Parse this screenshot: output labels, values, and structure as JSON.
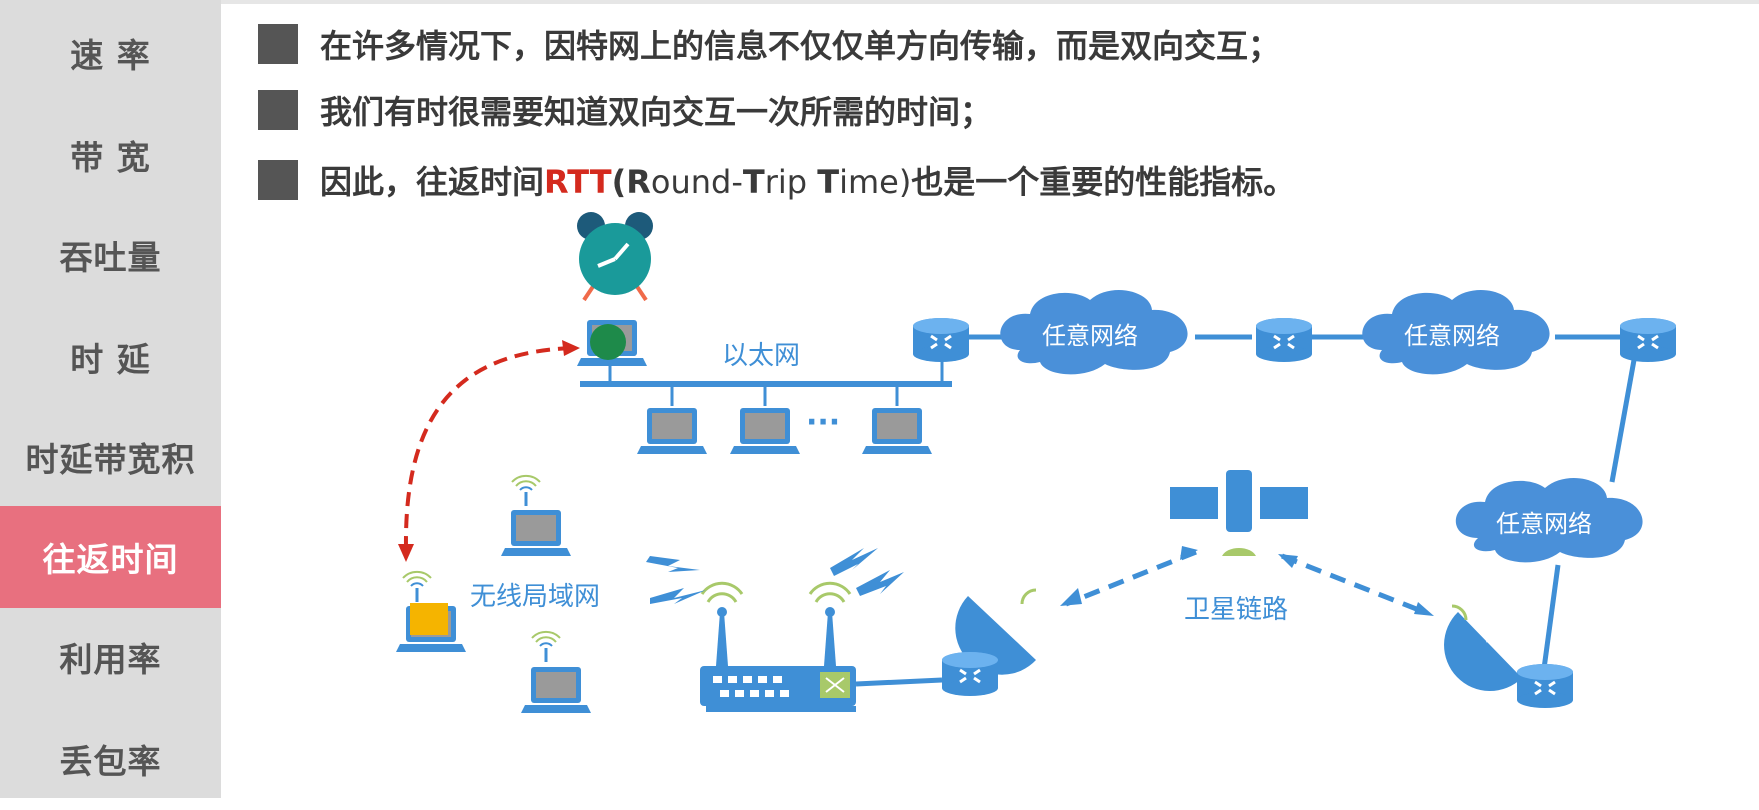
{
  "sidebar": {
    "items": [
      {
        "label": "速 率"
      },
      {
        "label": "带 宽"
      },
      {
        "label": "吞吐量"
      },
      {
        "label": "时 延"
      },
      {
        "label": "时延带宽积"
      },
      {
        "label": "往返时间",
        "active": true
      },
      {
        "label": "利用率"
      },
      {
        "label": "丢包率"
      }
    ]
  },
  "bullets": [
    {
      "text": "在许多情况下，因特网上的信息不仅仅单方向传输，而是双向交互；"
    },
    {
      "text": "我们有时很需要知道双向交互一次所需的时间；"
    },
    {
      "prefix": "因此，往返时间",
      "rtt": "RTT",
      "open": "(",
      "r": "R",
      "ound": "ound-",
      "t": "T",
      "rip": "rip ",
      "t2": "T",
      "ime": "ime)",
      "suffix": "也是一个重要的性能指标。"
    }
  ],
  "diagram": {
    "ethernet_label": "以太网",
    "wlan_label": "无线局域网",
    "satellite_label": "卫星链路",
    "cloud_label": "任意网络",
    "ellipsis": "···"
  },
  "colors": {
    "accent": "#e8707f",
    "rtt_red": "#d42a1e",
    "network_blue": "#3f8fd6",
    "cloud_blue": "#4a90d9",
    "arrow_red": "#d42a1e",
    "clock_teal": "#1a9a9a",
    "device_green": "#1e8a4a",
    "device_yellow": "#f5b400"
  }
}
